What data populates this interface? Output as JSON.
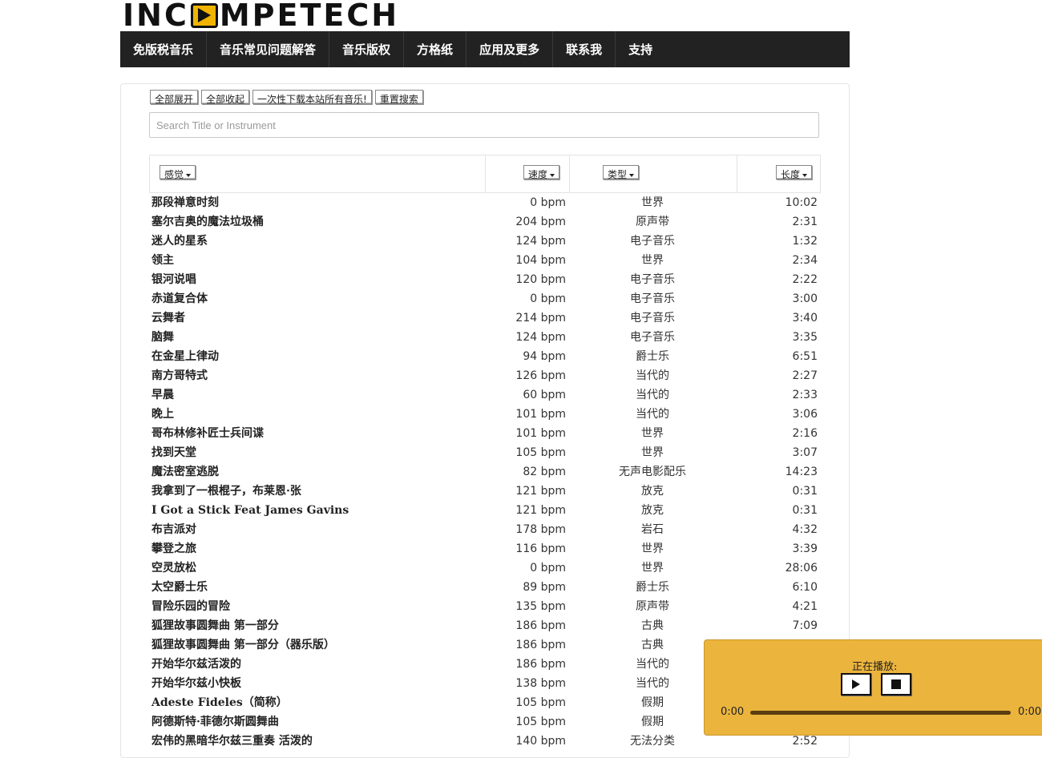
{
  "logo": {
    "text_before": "INC",
    "text_after": "MPETECH",
    "icon": "play-icon",
    "accent": "#f0b400"
  },
  "nav": {
    "items": [
      "免版税音乐",
      "音乐常见问题解答",
      "音乐版权",
      "方格纸",
      "应用及更多",
      "联系我",
      "支持"
    ]
  },
  "toolbar": {
    "expand_all": "全部展开",
    "collapse_all": "全部收起",
    "download_all": "一次性下载本站所有音乐!",
    "reset_search": "重置搜索"
  },
  "search": {
    "placeholder": "Search Title or Instrument",
    "value": ""
  },
  "table": {
    "headers": {
      "feel": "感觉",
      "speed": "速度",
      "genre": "类型",
      "length": "长度"
    },
    "rows": [
      {
        "title": "那段禅意时刻",
        "speed": "0 bpm",
        "genre": "世界",
        "length": "10:02"
      },
      {
        "title": "塞尔吉奥的魔法垃圾桶",
        "speed": "204 bpm",
        "genre": "原声带",
        "length": "2:31"
      },
      {
        "title": "迷人的星系",
        "speed": "124 bpm",
        "genre": "电子音乐",
        "length": "1:32"
      },
      {
        "title": "领主",
        "speed": "104 bpm",
        "genre": "世界",
        "length": "2:34"
      },
      {
        "title": "银河说唱",
        "speed": "120 bpm",
        "genre": "电子音乐",
        "length": "2:22"
      },
      {
        "title": "赤道复合体",
        "speed": "0 bpm",
        "genre": "电子音乐",
        "length": "3:00"
      },
      {
        "title": "云舞者",
        "speed": "214 bpm",
        "genre": "电子音乐",
        "length": "3:40"
      },
      {
        "title": "脑舞",
        "speed": "124 bpm",
        "genre": "电子音乐",
        "length": "3:35"
      },
      {
        "title": "在金星上律动",
        "speed": "94 bpm",
        "genre": "爵士乐",
        "length": "6:51"
      },
      {
        "title": "南方哥特式",
        "speed": "126 bpm",
        "genre": "当代的",
        "length": "2:27"
      },
      {
        "title": "早晨",
        "speed": "60 bpm",
        "genre": "当代的",
        "length": "2:33"
      },
      {
        "title": "晚上",
        "speed": "101 bpm",
        "genre": "当代的",
        "length": "3:06"
      },
      {
        "title": "哥布林修补匠士兵间谍",
        "speed": "101 bpm",
        "genre": "世界",
        "length": "2:16"
      },
      {
        "title": "找到天堂",
        "speed": "105 bpm",
        "genre": "世界",
        "length": "3:07"
      },
      {
        "title": "魔法密室逃脱",
        "speed": "82 bpm",
        "genre": "无声电影配乐",
        "length": "14:23"
      },
      {
        "title": "我拿到了一根棍子，布莱恩·张",
        "speed": "121 bpm",
        "genre": "放克",
        "length": "0:31"
      },
      {
        "title": "I Got a Stick Feat James Gavins",
        "speed": "121 bpm",
        "genre": "放克",
        "length": "0:31"
      },
      {
        "title": "布吉派对",
        "speed": "178 bpm",
        "genre": "岩石",
        "length": "4:32"
      },
      {
        "title": "攀登之旅",
        "speed": "116 bpm",
        "genre": "世界",
        "length": "3:39"
      },
      {
        "title": "空灵放松",
        "speed": "0 bpm",
        "genre": "世界",
        "length": "28:06"
      },
      {
        "title": "太空爵士乐",
        "speed": "89 bpm",
        "genre": "爵士乐",
        "length": "6:10"
      },
      {
        "title": "冒险乐园的冒险",
        "speed": "135 bpm",
        "genre": "原声带",
        "length": "4:21"
      },
      {
        "title": "狐狸故事圆舞曲 第一部分",
        "speed": "186 bpm",
        "genre": "古典",
        "length": "7:09"
      },
      {
        "title": "狐狸故事圆舞曲 第一部分（器乐版）",
        "speed": "186 bpm",
        "genre": "古典",
        "length": ""
      },
      {
        "title": "开始华尔兹活泼的",
        "speed": "186 bpm",
        "genre": "当代的",
        "length": ""
      },
      {
        "title": "开始华尔兹小快板",
        "speed": "138 bpm",
        "genre": "当代的",
        "length": ""
      },
      {
        "title": "Adeste Fideles（简称）",
        "speed": "105 bpm",
        "genre": "假期",
        "length": ""
      },
      {
        "title": "阿德斯特·菲德尔斯圆舞曲",
        "speed": "105 bpm",
        "genre": "假期",
        "length": ""
      },
      {
        "title": "宏伟的黑暗华尔兹三重奏 活泼的",
        "speed": "140 bpm",
        "genre": "无法分类",
        "length": "2:52"
      }
    ]
  },
  "player": {
    "now_playing_label": "正在播放:",
    "time_current": "0:00",
    "time_total": "0:00",
    "background": "#ebb43c"
  }
}
